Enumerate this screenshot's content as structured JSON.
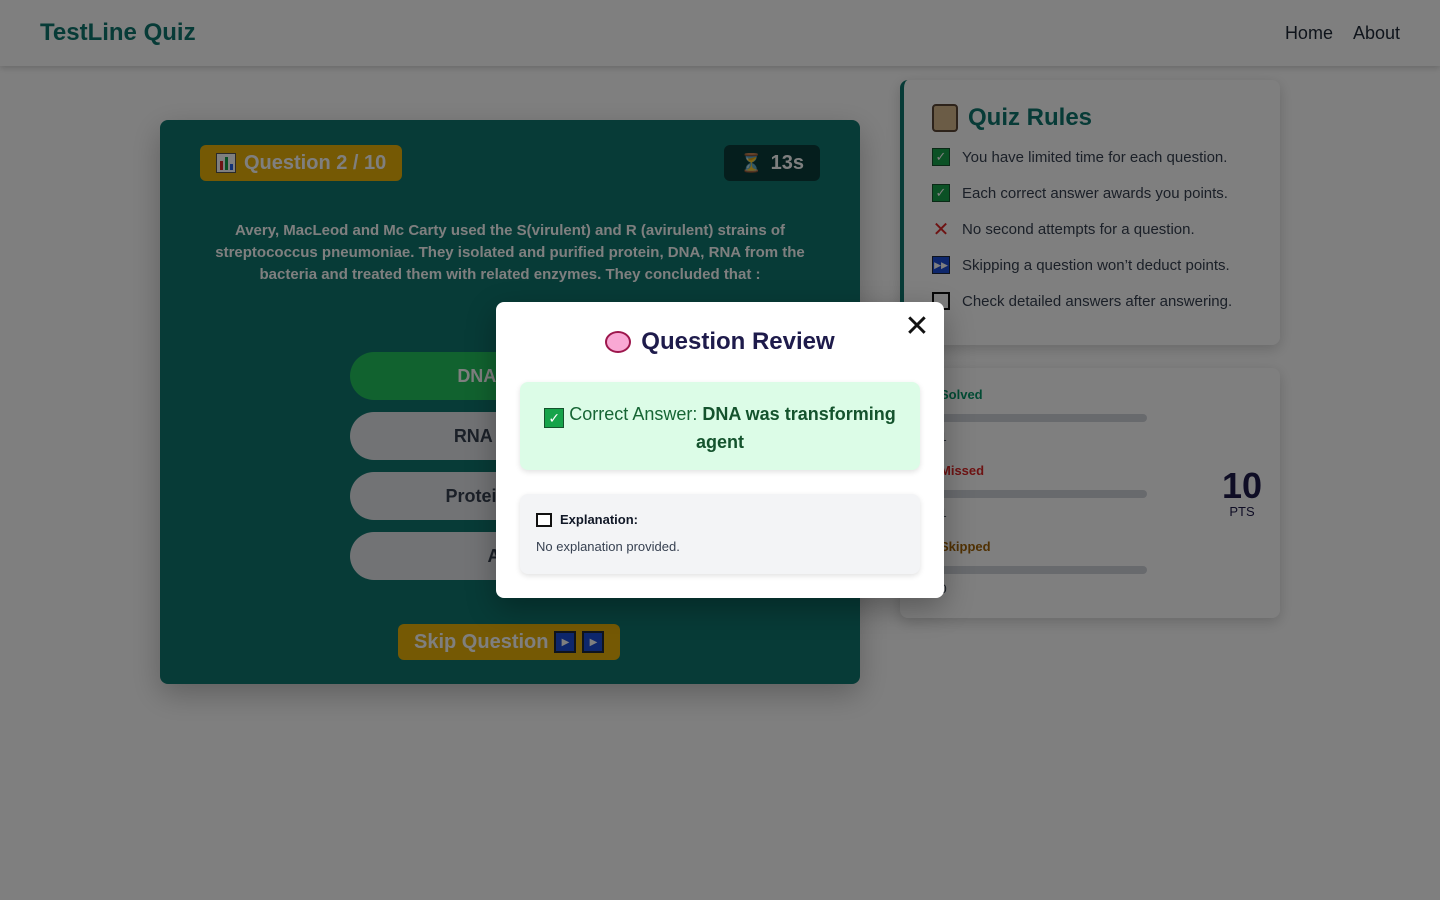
{
  "navbar": {
    "brand": "TestLine Quiz",
    "links": [
      "Home",
      "About"
    ]
  },
  "quiz": {
    "counter_label": "Question 2 / 10",
    "counter_icon": "bar-chart-icon",
    "timer_label": "13s",
    "timer_icon": "hourglass-icon",
    "question": "Avery, MacLeod and Mc Carty used the S(virulent) and R (avirulent) strains of streptococcus pneumoniae. They isolated and purified protein, DNA, RNA from the bacteria and treated them with related enzymes. They concluded that :",
    "options": [
      "DNA was tra",
      "RNA was trar",
      "Protein was tra",
      "All ar"
    ],
    "skip_label": "Skip Question",
    "skip_icon": "fast-forward-icon"
  },
  "rules": {
    "title": "Quiz Rules",
    "title_icon": "scroll-icon",
    "items": [
      {
        "text": "You have limited time for each question.",
        "icon": "check-icon"
      },
      {
        "text": "Each correct answer awards you points.",
        "icon": "check-icon"
      },
      {
        "text": "No second attempts for a question.",
        "icon": "cross-icon"
      },
      {
        "text": "Skipping a question won’t deduct points.",
        "icon": "fast-forward-icon"
      },
      {
        "text": "Check detailed answers after answering.",
        "icon": "memo-icon"
      }
    ]
  },
  "stats": {
    "solved": {
      "label": "Solved",
      "color": "#059669",
      "fill_fraction": 0.1,
      "count": "1"
    },
    "missed": {
      "label": "Missed",
      "color": "#dc2626",
      "fill_fraction": 0.1,
      "count": "1"
    },
    "skipped": {
      "label": "Skipped",
      "color": "#a16207",
      "fill_fraction": 0.0,
      "count": "0"
    },
    "points_value": "10",
    "points_unit": "PTS"
  },
  "modal": {
    "title": "Question Review",
    "title_icon": "brain-icon",
    "answer_prefix": "Correct Answer: ",
    "answer_text": "DNA was transforming agent",
    "explanation_title": "Explanation:",
    "explanation_text": "No explanation provided."
  },
  "colors": {
    "primary": "#0f766e",
    "accent": "#eab308",
    "success": "#22c55e"
  }
}
